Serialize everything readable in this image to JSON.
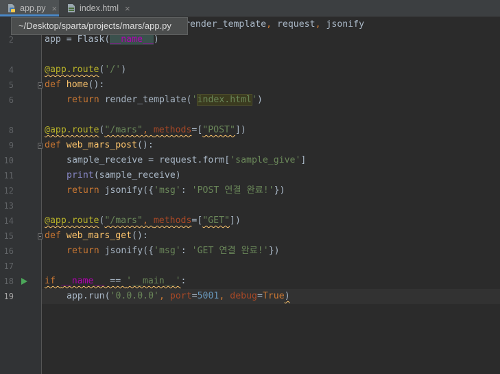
{
  "tabs": [
    {
      "label": "app.py",
      "icon": "python-file-icon",
      "active": true,
      "close": "×"
    },
    {
      "label": "index.html",
      "icon": "html-file-icon",
      "active": false,
      "close": "×"
    }
  ],
  "tooltip": {
    "text": "~/Desktop/sparta/projects/mars/app.py"
  },
  "line_numbers": [
    "2",
    "4",
    "5",
    "6",
    "8",
    "9",
    "10",
    "11",
    "12",
    "13",
    "14",
    "15",
    "16",
    "17",
    "18",
    "19"
  ],
  "code": {
    "l1_tail": [
      "render_template",
      ", ",
      "request",
      ", ",
      "jsonify"
    ],
    "l2": [
      "app",
      " = ",
      "Flask",
      "(",
      "__name__",
      ")"
    ],
    "l4": [
      "@app.route",
      "(",
      "'/'",
      ")"
    ],
    "l5": [
      "def ",
      "home",
      "():"
    ],
    "l6": [
      "return ",
      "render_template(",
      "'",
      "index.html",
      "'",
      ")"
    ],
    "l8": [
      "@app.route",
      "(",
      "\"/mars\"",
      ", ",
      "methods",
      "=[",
      "\"POST\"",
      "])"
    ],
    "l9": [
      "def ",
      "web_mars_post",
      "():"
    ],
    "l10": [
      "sample_receive = request.form[",
      "'sample_give'",
      "]"
    ],
    "l11": [
      "print",
      "(sample_receive)"
    ],
    "l12": [
      "return ",
      "jsonify({",
      "'msg'",
      ": ",
      "'POST 연결 완료!'",
      "})"
    ],
    "l14": [
      "@app.route",
      "(",
      "\"/mars\"",
      ", ",
      "methods",
      "=[",
      "\"GET\"",
      "])"
    ],
    "l15": [
      "def ",
      "web_mars_get",
      "():"
    ],
    "l16": [
      "return ",
      "jsonify({",
      "'msg'",
      ": ",
      "'GET 연결 완료!'",
      "})"
    ],
    "l18": [
      "if ",
      "__name__",
      " == ",
      "'__main__'",
      ":"
    ],
    "l19": [
      "app.run(",
      "'0.0.0.0'",
      ", ",
      "port",
      "=",
      "5001",
      ", ",
      "debug",
      "=",
      "True",
      ")"
    ]
  },
  "colors": {
    "background": "#2b2b2b",
    "keyword": "#cc7832",
    "function": "#ffc66d",
    "string": "#6a8759",
    "decorator": "#bbb529",
    "number": "#6897bb",
    "param": "#aa4926",
    "dunder": "#b200b2",
    "run": "#4ca85a"
  }
}
